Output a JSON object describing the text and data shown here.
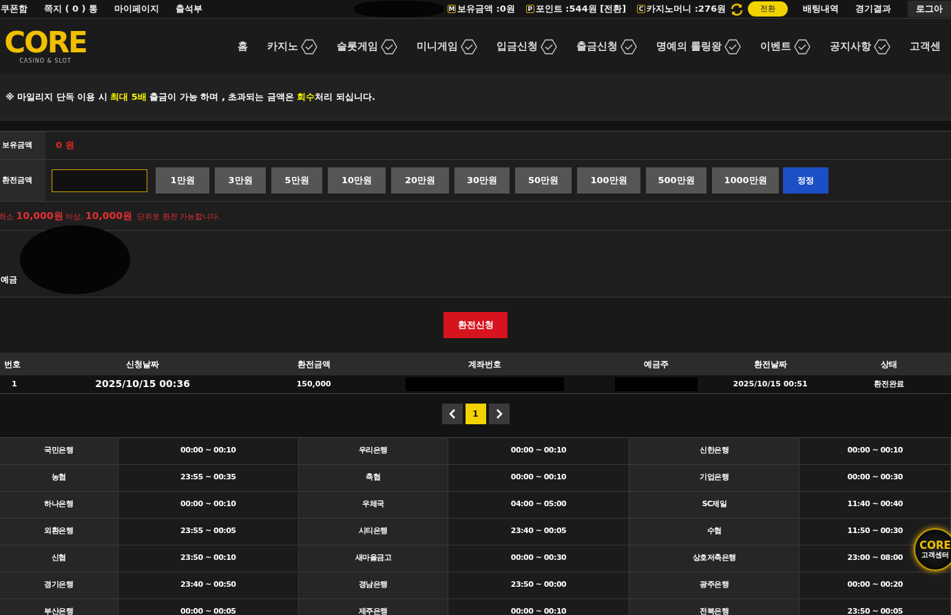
{
  "top_links": [
    "쿠폰함",
    "쪽지 ( 0 ) 통",
    "마이페이지",
    "출석부"
  ],
  "wallet": [
    {
      "icon": "M",
      "label": "보유금액 :",
      "value": "0",
      "unit": "원"
    },
    {
      "icon": "P",
      "label": "포인트 :",
      "value": "544",
      "unit": "원 [전환]"
    },
    {
      "icon": "C",
      "label": "카지노머니 :",
      "value": "276",
      "unit": "원"
    }
  ],
  "convert_button": "전환",
  "right_links": [
    "배팅내역",
    "경기결과"
  ],
  "logout": "로그아",
  "logo": {
    "main": "CORE",
    "sub": "CASINO & SLOT"
  },
  "nav": [
    {
      "label": "홈",
      "icon": false
    },
    {
      "label": "카지노",
      "icon": true
    },
    {
      "label": "슬롯게임",
      "icon": true
    },
    {
      "label": "미니게임",
      "icon": true
    },
    {
      "label": "입금신청",
      "icon": true
    },
    {
      "label": "출금신청",
      "icon": true
    },
    {
      "label": "명예의 롤링왕",
      "icon": true
    },
    {
      "label": "이벤트",
      "icon": true
    },
    {
      "label": "공지사항",
      "icon": true
    },
    {
      "label": "고객센",
      "icon": false
    }
  ],
  "notice": "※ 마일리지 단독 이용 시 **최대 5배** 출금이 가능 하며 , 초과되는 금액은 **회수**처리 되십니다.",
  "form": {
    "balance_label": "보유금액",
    "balance": "0 원",
    "amount_label": "환전금액",
    "amounts": [
      "1만원",
      "3만원",
      "5만원",
      "10만원",
      "20만원",
      "30만원",
      "50만원",
      "100만원",
      "500만원",
      "1000만원"
    ],
    "reset": "정정"
  },
  "min_note": "최소 **10,000원** 이상, **10,000원**  단위로 환전 가능합니다.",
  "holder_label": "예금",
  "submit": "환전신청",
  "history": {
    "columns": [
      "번호",
      "신청날짜",
      "환전금액",
      "계좌번호",
      "예금주",
      "환전날짜",
      "상태"
    ],
    "rows": [
      {
        "no": "1",
        "requested": "2025/10/15 00:36",
        "amount": "150,000",
        "done": "2025/10/15 00:51",
        "status": "환전완료"
      }
    ]
  },
  "pagination": {
    "pages": [
      {
        "label": "1",
        "selected": true
      }
    ]
  },
  "banks": [
    [
      "국민은행",
      "00:00 ~ 00:10",
      "우리은행",
      "00:00 ~ 00:10",
      "신한은행",
      "00:00 ~ 00:10"
    ],
    [
      "농협",
      "23:55 ~ 00:35",
      "축협",
      "00:00 ~ 00:10",
      "기업은행",
      "00:00 ~ 00:30"
    ],
    [
      "하나은행",
      "00:00 ~ 00:10",
      "우체국",
      "04:00 ~ 05:00",
      "SC제일",
      "11:40 ~ 00:40"
    ],
    [
      "외환은행",
      "23:55 ~ 00:05",
      "시티은행",
      "23:40 ~ 00:05",
      "수협",
      "11:50 ~ 00:30"
    ],
    [
      "신협",
      "23:50 ~ 00:10",
      "새마을금고",
      "00:00 ~ 00:30",
      "상호저축은행",
      "23:00 ~ 08:00"
    ],
    [
      "경기은행",
      "23:40 ~ 00:50",
      "경남은행",
      "23:50 ~ 00:00",
      "광주은행",
      "00:00 ~ 00:20"
    ],
    [
      "부산은행",
      "00:00 ~ 00:05",
      "제주은행",
      "00:00 ~ 00:10",
      "전북은행",
      "23:50 ~ 00:05"
    ]
  ],
  "support_badge": {
    "main": "CORE",
    "sub": "고객센터"
  }
}
